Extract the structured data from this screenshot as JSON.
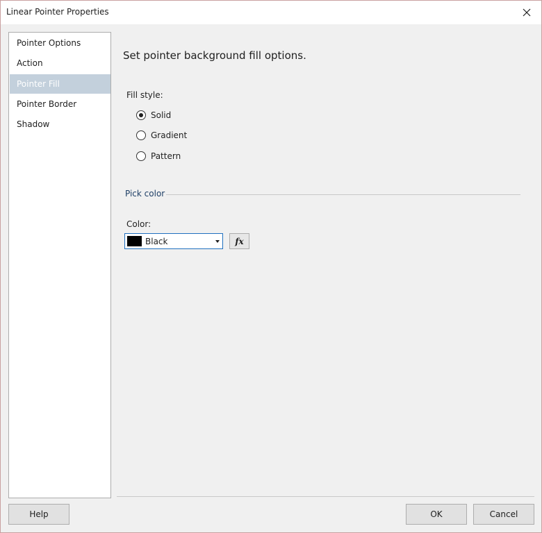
{
  "window": {
    "title": "Linear Pointer Properties"
  },
  "nav": {
    "items": [
      {
        "label": "Pointer Options",
        "selected": false
      },
      {
        "label": "Action",
        "selected": false
      },
      {
        "label": "Pointer Fill",
        "selected": true
      },
      {
        "label": "Pointer Border",
        "selected": false
      },
      {
        "label": "Shadow",
        "selected": false
      }
    ]
  },
  "main": {
    "heading": "Set pointer background fill options.",
    "fill_style_label": "Fill style:",
    "fill_options": [
      {
        "label": "Solid",
        "checked": true
      },
      {
        "label": "Gradient",
        "checked": false
      },
      {
        "label": "Pattern",
        "checked": false
      }
    ],
    "pick_color_label": "Pick color",
    "color_label": "Color:",
    "color_value": "Black",
    "color_swatch": "#000000",
    "fx_label": "fx"
  },
  "footer": {
    "help_label": "Help",
    "ok_label": "OK",
    "cancel_label": "Cancel"
  },
  "colors": {
    "selected_nav_bg": "#c3d0dc",
    "section_label": "#1e3f66",
    "focus_border": "#1f6fbf"
  },
  "icons": {
    "close": "close-icon",
    "dropdown": "chevron-down-icon"
  }
}
